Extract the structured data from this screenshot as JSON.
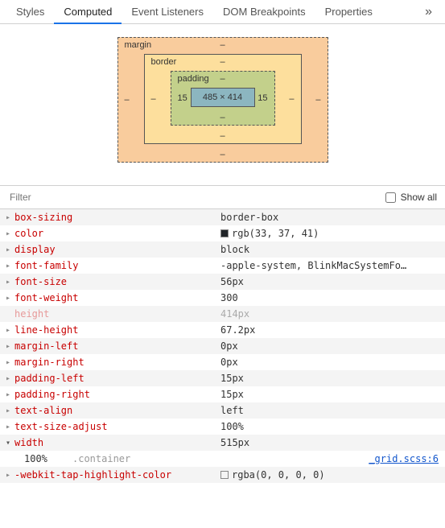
{
  "tabs": {
    "items": [
      "Styles",
      "Computed",
      "Event Listeners",
      "DOM Breakpoints",
      "Properties"
    ],
    "overflow": "»"
  },
  "boxmodel": {
    "margin": {
      "label": "margin",
      "top": "–",
      "right": "–",
      "bottom": "–",
      "left": "–"
    },
    "border": {
      "label": "border",
      "top": "–",
      "right": "–",
      "bottom": "–",
      "left": "–"
    },
    "padding": {
      "label": "padding",
      "top": "–",
      "right": "15",
      "bottom": "–",
      "left": "15"
    },
    "content": "485 × 414"
  },
  "filter": {
    "placeholder": "Filter",
    "showall_label": "Show all"
  },
  "props": [
    {
      "name": "box-sizing",
      "value": "border-box"
    },
    {
      "name": "color",
      "value": "rgb(33, 37, 41)",
      "swatch": "#212529"
    },
    {
      "name": "display",
      "value": "block"
    },
    {
      "name": "font-family",
      "value": "-apple-system, BlinkMacSystemFo…"
    },
    {
      "name": "font-size",
      "value": "56px"
    },
    {
      "name": "font-weight",
      "value": "300"
    },
    {
      "name": "height",
      "value": "414px",
      "inactive": true
    },
    {
      "name": "line-height",
      "value": "67.2px"
    },
    {
      "name": "margin-left",
      "value": "0px"
    },
    {
      "name": "margin-right",
      "value": "0px"
    },
    {
      "name": "padding-left",
      "value": "15px"
    },
    {
      "name": "padding-right",
      "value": "15px"
    },
    {
      "name": "text-align",
      "value": "left"
    },
    {
      "name": "text-size-adjust",
      "value": "100%"
    },
    {
      "name": "width",
      "value": "515px",
      "expanded": true,
      "child": {
        "value": "100%",
        "selector": ".container",
        "source": "_grid.scss:6"
      }
    },
    {
      "name": "-webkit-tap-highlight-color",
      "value": "rgba(0, 0, 0, 0)",
      "swatch": "rgba(0,0,0,0)"
    }
  ]
}
